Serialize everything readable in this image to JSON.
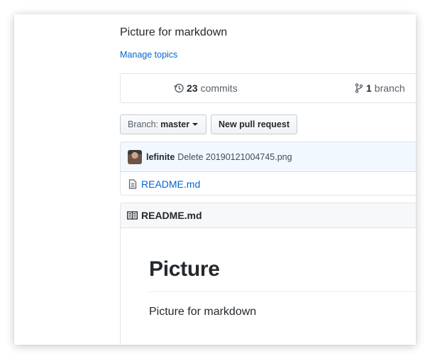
{
  "repo": {
    "description": "Picture for markdown",
    "manage_topics": "Manage topics"
  },
  "summary": {
    "commits_count": "23",
    "commits_label": "commits",
    "branch_count": "1",
    "branch_label": "branch"
  },
  "toolbar": {
    "branch_label": "Branch:",
    "branch_value": "master",
    "new_pr_label": "New pull request"
  },
  "latest_commit": {
    "author": "lefinite",
    "message": "Delete 20190121004745.png"
  },
  "files": [
    {
      "name": "README.md",
      "icon": "file-icon"
    }
  ],
  "readme": {
    "header": "README.md",
    "heading": "Picture",
    "paragraph": "Picture for markdown"
  },
  "colors": {
    "link": "#0366d6",
    "text": "#24292e",
    "commit_bg": "#f1f8ff",
    "border": "#e1e4e8"
  }
}
